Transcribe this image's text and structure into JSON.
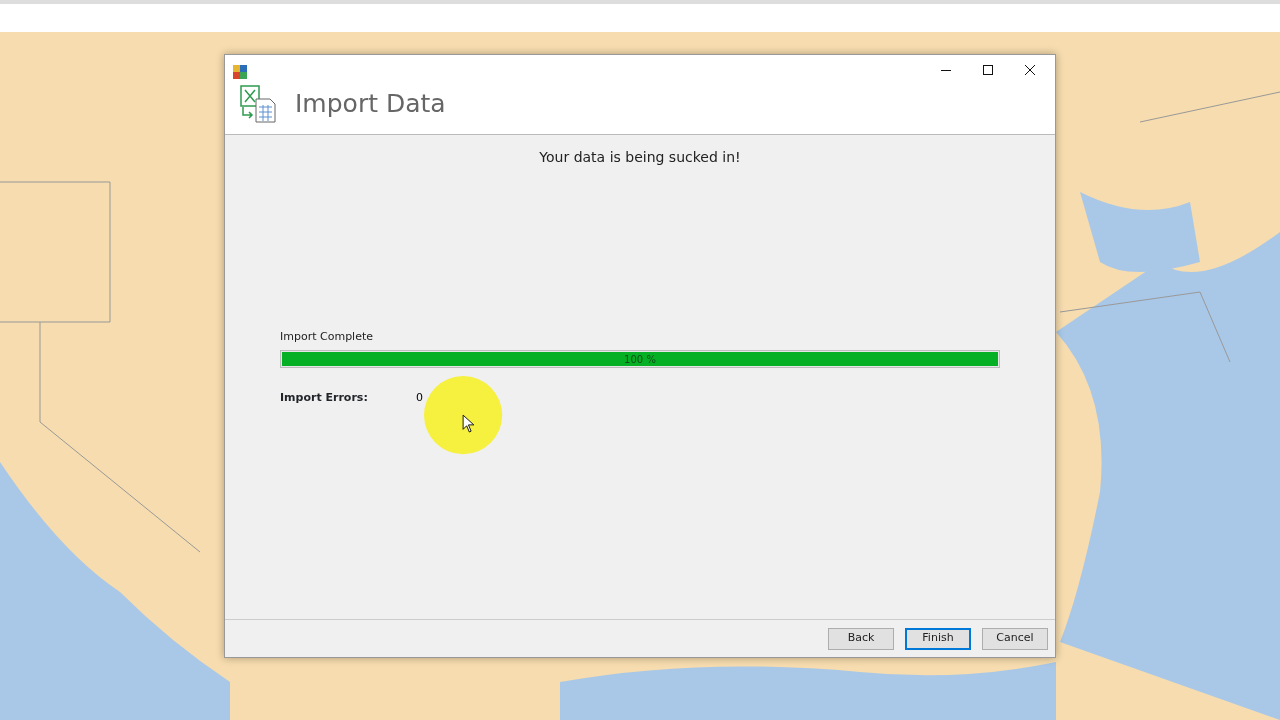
{
  "dialog": {
    "title": "Import Data",
    "message": "Your data is being sucked in!",
    "progress": {
      "label": "Import Complete",
      "level": 1.0,
      "reading": "100 %"
    },
    "errors": {
      "label": "Import Errors:",
      "value": "0"
    },
    "buttons": [
      {
        "label": "Back",
        "default": false
      },
      {
        "label": "Finish",
        "default": true
      },
      {
        "label": "Cancel",
        "default": false
      }
    ]
  }
}
